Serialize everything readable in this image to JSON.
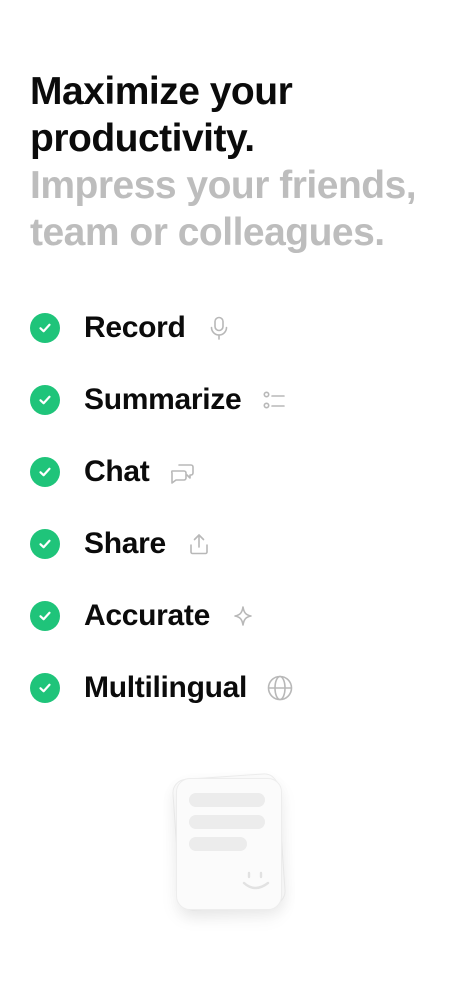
{
  "heading": {
    "primary": "Maximize your productivity.",
    "secondary": "Impress your friends, team or colleagues."
  },
  "features": [
    {
      "label": "Record",
      "icon": "microphone-icon"
    },
    {
      "label": "Summarize",
      "icon": "list-icon"
    },
    {
      "label": "Chat",
      "icon": "chat-bubbles-icon"
    },
    {
      "label": "Share",
      "icon": "share-icon"
    },
    {
      "label": "Accurate",
      "icon": "sparkle-icon"
    },
    {
      "label": "Multilingual",
      "icon": "globe-icon"
    }
  ],
  "colors": {
    "check": "#1fc47a",
    "heading_primary": "#0b0b0b",
    "heading_secondary": "#bdbdbd",
    "feature_icon": "#b8b8b8"
  }
}
